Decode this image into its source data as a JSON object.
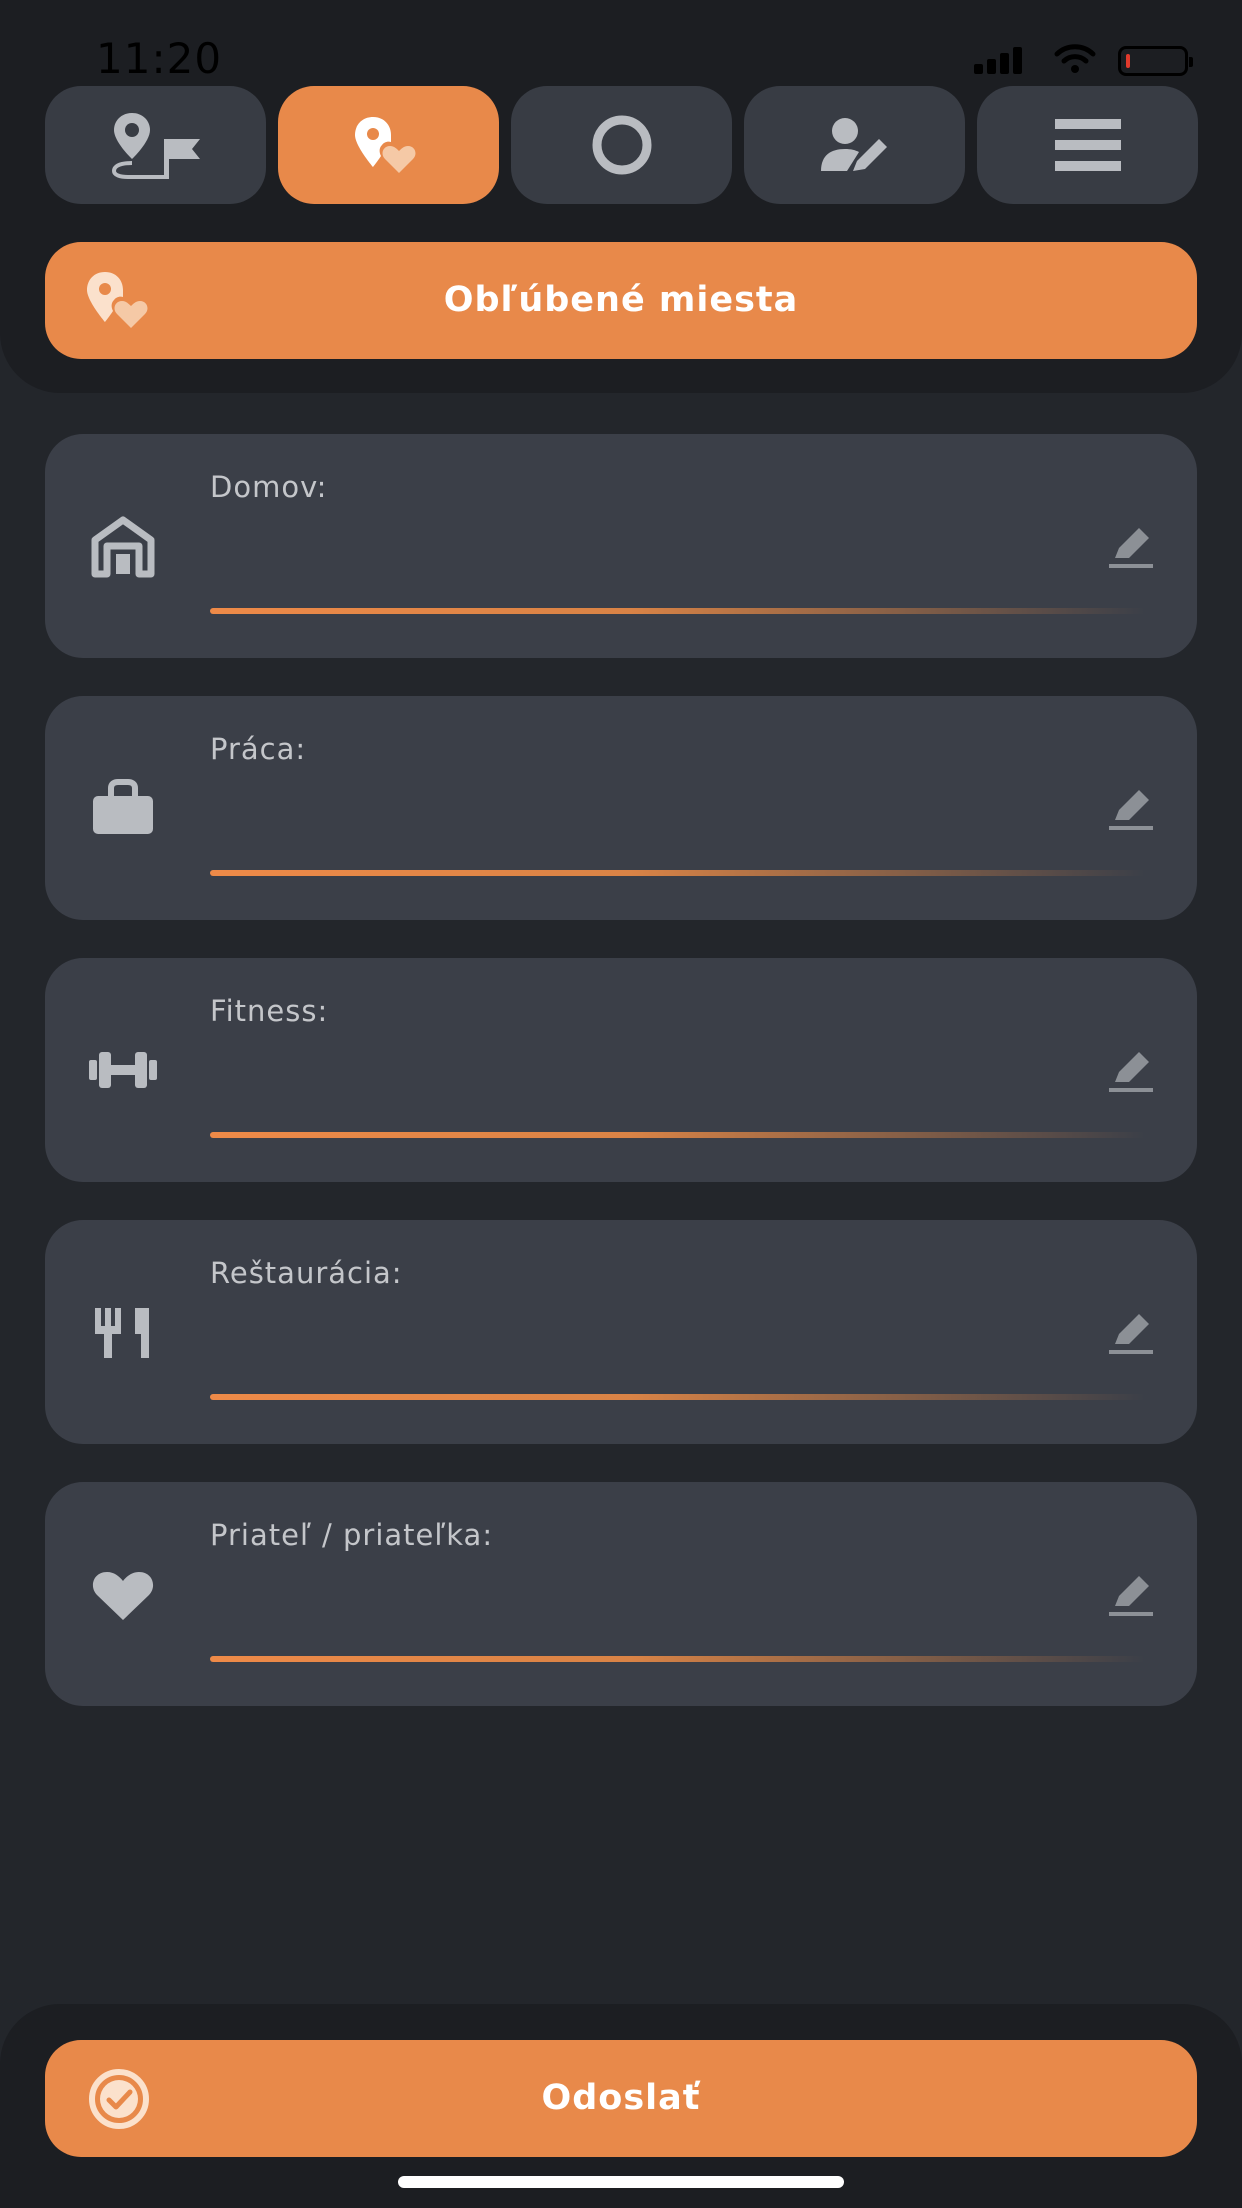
{
  "status_bar": {
    "time": "11:20"
  },
  "tabs": [
    {
      "icon": "map-pin-flag-icon",
      "active": false
    },
    {
      "icon": "favorite-place-icon",
      "active": true
    },
    {
      "icon": "circle-icon",
      "active": false
    },
    {
      "icon": "user-edit-icon",
      "active": false
    },
    {
      "icon": "hamburger-menu-icon",
      "active": false
    }
  ],
  "section": {
    "title": "Obľúbené miesta",
    "icon": "favorite-place-icon"
  },
  "places": [
    {
      "label": "Domov:",
      "value": "",
      "icon": "home-icon"
    },
    {
      "label": "Práca:",
      "value": "",
      "icon": "briefcase-icon"
    },
    {
      "label": "Fitness:",
      "value": "",
      "icon": "dumbbell-icon"
    },
    {
      "label": "Reštaurácia:",
      "value": "",
      "icon": "fork-knife-icon"
    },
    {
      "label": "Priateľ / priateľka:",
      "value": "",
      "icon": "heart-icon"
    }
  ],
  "submit": {
    "label": "Odoslať",
    "icon": "check-circle-icon"
  },
  "colors": {
    "accent": "#e8894a",
    "background": "#23262b",
    "header": "#1c1e22",
    "card": "#3b3f48",
    "icon": "#b9bcc1"
  }
}
